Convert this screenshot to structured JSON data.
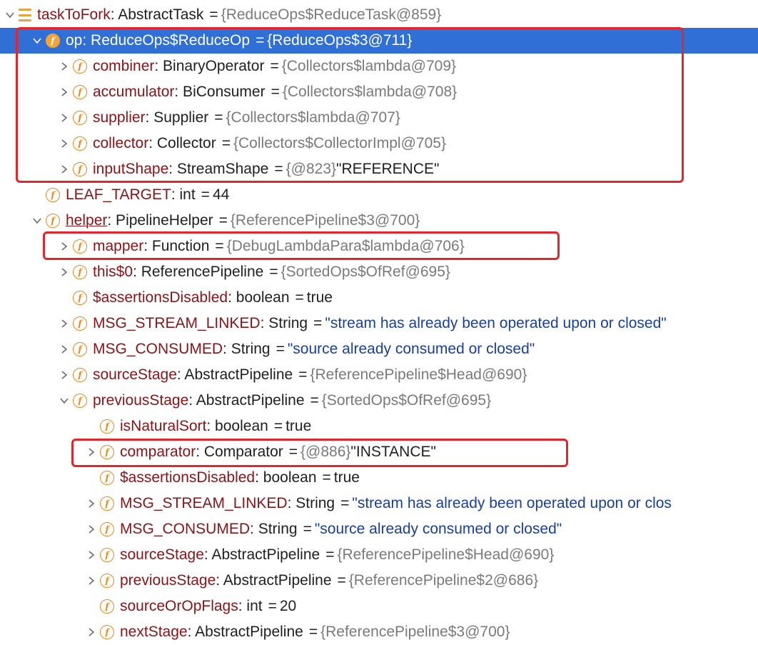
{
  "variables_tree": [
    {
      "indent": 0,
      "expander": "expanded",
      "icon": "list-icon",
      "name": "taskToFork",
      "type": "AbstractTask",
      "ref": "{ReduceOps$ReduceTask@859}",
      "value": ""
    },
    {
      "indent": 1,
      "expander": "expanded",
      "icon": "field-icon",
      "name": "op",
      "type": "ReduceOps$ReduceOp",
      "ref": "{ReduceOps$3@711}",
      "value": "",
      "selected": true
    },
    {
      "indent": 2,
      "expander": "collapsed",
      "icon": "field-icon",
      "name": "combiner",
      "type": "BinaryOperator",
      "ref": "{Collectors$lambda@709}",
      "value": ""
    },
    {
      "indent": 2,
      "expander": "collapsed",
      "icon": "field-icon",
      "name": "accumulator",
      "type": "BiConsumer",
      "ref": "{Collectors$lambda@708}",
      "value": ""
    },
    {
      "indent": 2,
      "expander": "collapsed",
      "icon": "field-icon",
      "name": "supplier",
      "type": "Supplier",
      "ref": "{Collectors$lambda@707}",
      "value": ""
    },
    {
      "indent": 2,
      "expander": "collapsed",
      "icon": "field-icon",
      "name": "collector",
      "type": "Collector",
      "ref": "{Collectors$CollectorImpl@705}",
      "value": ""
    },
    {
      "indent": 2,
      "expander": "collapsed",
      "icon": "field-icon",
      "name": "inputShape",
      "type": "StreamShape",
      "ref": "{@823}",
      "value": "\"REFERENCE\""
    },
    {
      "indent": 1,
      "expander": "none",
      "icon": "field-icon",
      "name": "LEAF_TARGET",
      "type": "int",
      "ref": "",
      "value": "44"
    },
    {
      "indent": 1,
      "expander": "expanded",
      "icon": "field-icon",
      "name": "helper",
      "type": "PipelineHelper",
      "ref": "{ReferencePipeline$3@700}",
      "value": "",
      "link": true
    },
    {
      "indent": 2,
      "expander": "collapsed",
      "icon": "field-icon",
      "name": "mapper",
      "type": "Function",
      "ref": "{DebugLambdaPara$lambda@706}",
      "value": ""
    },
    {
      "indent": 2,
      "expander": "collapsed",
      "icon": "field-icon",
      "name": "this$0",
      "type": "ReferencePipeline",
      "ref": "{SortedOps$OfRef@695}",
      "value": ""
    },
    {
      "indent": 2,
      "expander": "none",
      "icon": "field-icon",
      "name": "$assertionsDisabled",
      "type": "boolean",
      "ref": "",
      "value": "true"
    },
    {
      "indent": 2,
      "expander": "collapsed",
      "icon": "field-icon",
      "name": "MSG_STREAM_LINKED",
      "type": "String",
      "ref": "",
      "value": "\"stream has already been operated upon or closed\"",
      "valueIsString": true
    },
    {
      "indent": 2,
      "expander": "collapsed",
      "icon": "field-icon",
      "name": "MSG_CONSUMED",
      "type": "String",
      "ref": "",
      "value": "\"source already consumed or closed\"",
      "valueIsString": true
    },
    {
      "indent": 2,
      "expander": "collapsed",
      "icon": "field-icon",
      "name": "sourceStage",
      "type": "AbstractPipeline",
      "ref": "{ReferencePipeline$Head@690}",
      "value": ""
    },
    {
      "indent": 2,
      "expander": "expanded",
      "icon": "field-icon",
      "name": "previousStage",
      "type": "AbstractPipeline",
      "ref": "{SortedOps$OfRef@695}",
      "value": ""
    },
    {
      "indent": 3,
      "expander": "none",
      "icon": "field-icon",
      "name": "isNaturalSort",
      "type": "boolean",
      "ref": "",
      "value": "true"
    },
    {
      "indent": 3,
      "expander": "collapsed",
      "icon": "field-icon",
      "name": "comparator",
      "type": "Comparator",
      "ref": "{@886}",
      "value": "\"INSTANCE\""
    },
    {
      "indent": 3,
      "expander": "none",
      "icon": "field-icon",
      "name": "$assertionsDisabled",
      "type": "boolean",
      "ref": "",
      "value": "true"
    },
    {
      "indent": 3,
      "expander": "collapsed",
      "icon": "field-icon",
      "name": "MSG_STREAM_LINKED",
      "type": "String",
      "ref": "",
      "value": "\"stream has already been operated upon or clos",
      "valueIsString": true
    },
    {
      "indent": 3,
      "expander": "collapsed",
      "icon": "field-icon",
      "name": "MSG_CONSUMED",
      "type": "String",
      "ref": "",
      "value": "\"source already consumed or closed\"",
      "valueIsString": true
    },
    {
      "indent": 3,
      "expander": "collapsed",
      "icon": "field-icon",
      "name": "sourceStage",
      "type": "AbstractPipeline",
      "ref": "{ReferencePipeline$Head@690}",
      "value": ""
    },
    {
      "indent": 3,
      "expander": "collapsed",
      "icon": "field-icon",
      "name": "previousStage",
      "type": "AbstractPipeline",
      "ref": "{ReferencePipeline$2@686}",
      "value": ""
    },
    {
      "indent": 3,
      "expander": "none",
      "icon": "field-icon",
      "name": "sourceOrOpFlags",
      "type": "int",
      "ref": "",
      "value": "20"
    },
    {
      "indent": 3,
      "expander": "collapsed",
      "icon": "field-icon",
      "name": "nextStage",
      "type": "AbstractPipeline",
      "ref": "{ReferencePipeline$3@700}",
      "value": ""
    }
  ],
  "field_badge_glyph": "f",
  "equals_sign": "=",
  "colors": {
    "selection": "#2f6fd6",
    "field_name": "#8a1318",
    "reference": "#7a7a7a",
    "string_value": "#1a3f9a",
    "field_icon": "#e8891c",
    "highlight_box": "#e3262c"
  }
}
